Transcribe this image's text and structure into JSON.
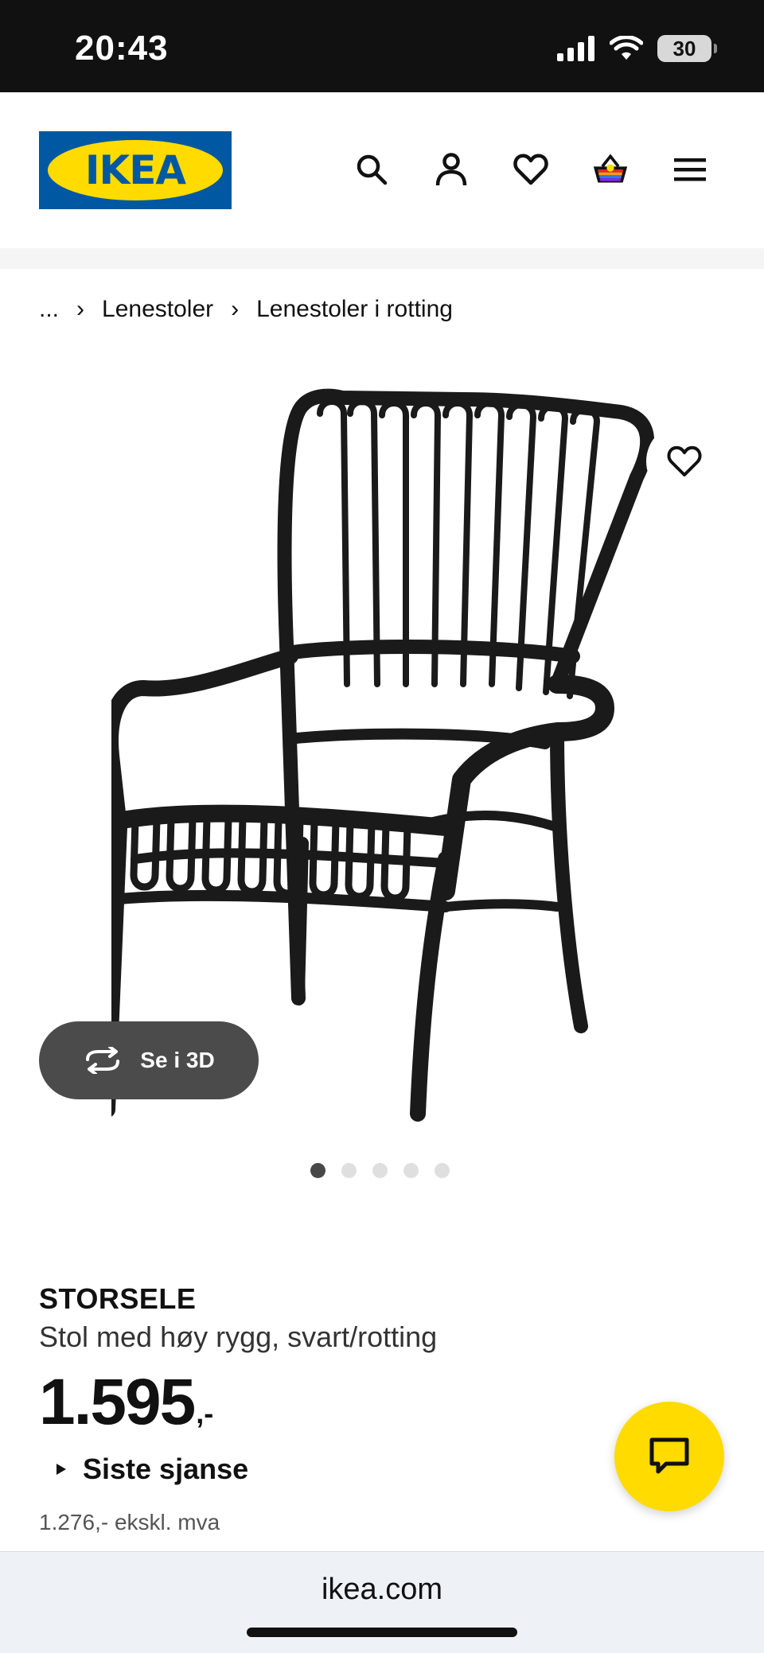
{
  "status_bar": {
    "time": "20:43",
    "battery": "30",
    "icons": [
      "signal-icon",
      "wifi-icon",
      "battery-icon"
    ]
  },
  "header": {
    "logo_text": "IKEA",
    "icons": [
      "search-icon",
      "account-icon",
      "heart-icon",
      "basket-icon",
      "menu-icon"
    ]
  },
  "breadcrumb": {
    "ellipsis": "...",
    "items": [
      "Lenestoler",
      "Lenestoler i rotting"
    ]
  },
  "product": {
    "image_alt": "STORSELE",
    "view_3d_label": "Se i 3D",
    "image_count": 5,
    "active_image": 1,
    "name": "STORSELE",
    "description": "Stol med høy rygg, svart/rotting",
    "price": "1.595",
    "price_suffix": ",-",
    "last_chance": "Siste sjanse",
    "price_ex_vat": "1.276,- ekskl. mva"
  },
  "browser": {
    "url": "ikea.com"
  },
  "colors": {
    "brand_blue": "#0058a3",
    "brand_yellow": "#ffdb00"
  }
}
